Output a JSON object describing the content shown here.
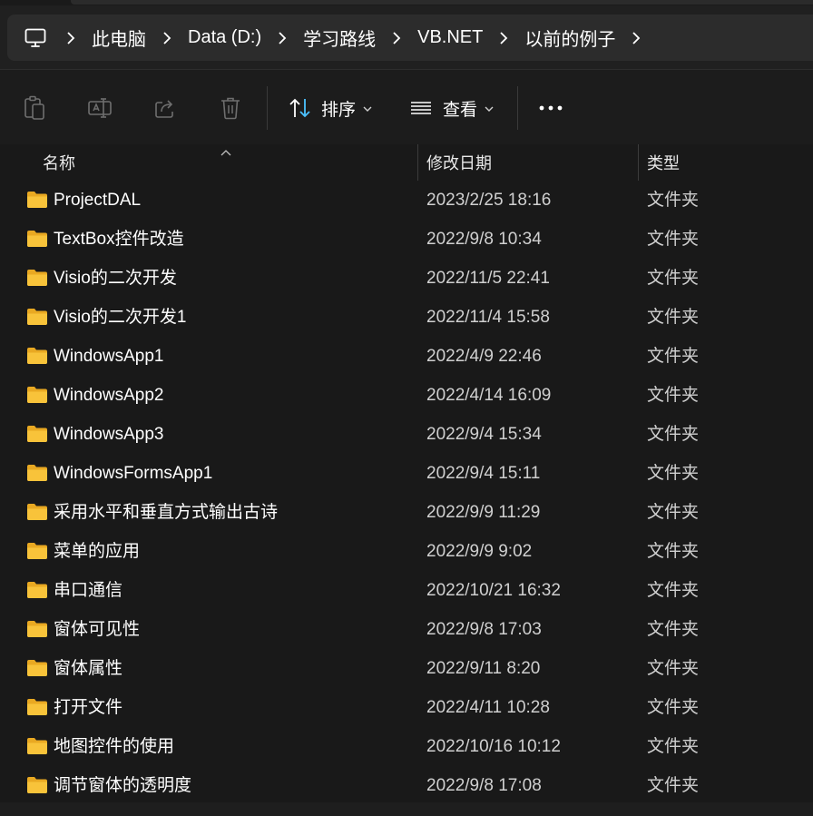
{
  "breadcrumb": {
    "items": [
      "此电脑",
      "Data (D:)",
      "学习路线",
      "VB.NET",
      "以前的例子"
    ]
  },
  "toolbar": {
    "sort_label": "排序",
    "view_label": "查看"
  },
  "columns": {
    "name": "名称",
    "date": "修改日期",
    "type": "类型"
  },
  "files": [
    {
      "name": "ProjectDAL",
      "date": "2023/2/25 18:16",
      "type": "文件夹"
    },
    {
      "name": "TextBox控件改造",
      "date": "2022/9/8 10:34",
      "type": "文件夹"
    },
    {
      "name": "Visio的二次开发",
      "date": "2022/11/5 22:41",
      "type": "文件夹"
    },
    {
      "name": "Visio的二次开发1",
      "date": "2022/11/4 15:58",
      "type": "文件夹"
    },
    {
      "name": "WindowsApp1",
      "date": "2022/4/9 22:46",
      "type": "文件夹"
    },
    {
      "name": "WindowsApp2",
      "date": "2022/4/14 16:09",
      "type": "文件夹"
    },
    {
      "name": "WindowsApp3",
      "date": "2022/9/4 15:34",
      "type": "文件夹"
    },
    {
      "name": "WindowsFormsApp1",
      "date": "2022/9/4 15:11",
      "type": "文件夹"
    },
    {
      "name": "采用水平和垂直方式输出古诗",
      "date": "2022/9/9 11:29",
      "type": "文件夹"
    },
    {
      "name": "菜单的应用",
      "date": "2022/9/9 9:02",
      "type": "文件夹"
    },
    {
      "name": "串口通信",
      "date": "2022/10/21 16:32",
      "type": "文件夹"
    },
    {
      "name": "窗体可见性",
      "date": "2022/9/8 17:03",
      "type": "文件夹"
    },
    {
      "name": "窗体属性",
      "date": "2022/9/11 8:20",
      "type": "文件夹"
    },
    {
      "name": "打开文件",
      "date": "2022/4/11 10:28",
      "type": "文件夹"
    },
    {
      "name": "地图控件的使用",
      "date": "2022/10/16 10:12",
      "type": "文件夹"
    },
    {
      "name": "调节窗体的透明度",
      "date": "2022/9/8 17:08",
      "type": "文件夹"
    }
  ],
  "icons": {
    "pc": "computer-icon",
    "folder": "folder-icon",
    "paste": "paste-icon",
    "rename": "rename-icon",
    "share": "share-icon",
    "delete": "delete-icon",
    "sort": "sort-icon",
    "view": "view-icon",
    "more": "more-icon"
  },
  "colors": {
    "folder_yellow": "#f8c33a",
    "accent_blue": "#4cc2ff"
  }
}
